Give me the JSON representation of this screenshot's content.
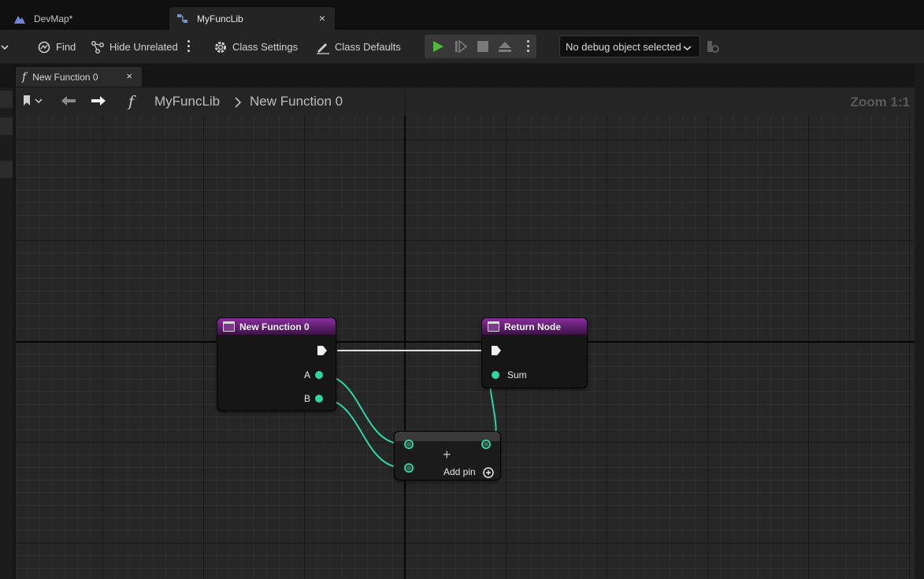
{
  "doc_tabs": [
    {
      "label": "DevMap*"
    },
    {
      "label": "MyFuncLib",
      "close": "×"
    }
  ],
  "toolbar": {
    "find": "Find",
    "hide_unrelated": "Hide Unrelated",
    "class_settings": "Class Settings",
    "class_defaults": "Class Defaults",
    "debug_object": "No debug object selected"
  },
  "function_tab": {
    "label": "New Function 0",
    "close": "×"
  },
  "breadcrumb": {
    "root": "MyFuncLib",
    "current": "New Function 0",
    "zoom": "Zoom 1:1"
  },
  "nodes": {
    "entry": {
      "title": "New Function 0",
      "pins": [
        "A",
        "B"
      ]
    },
    "return": {
      "title": "Return Node",
      "pins": [
        "Sum"
      ]
    },
    "add": {
      "add_pin_label": "Add pin",
      "operator": "+"
    }
  },
  "colors": {
    "pin_float": "#30d5a6",
    "function_header": "#8a2fa0",
    "exec_wire": "#e0e0e0",
    "play": "#4dbb3a"
  }
}
